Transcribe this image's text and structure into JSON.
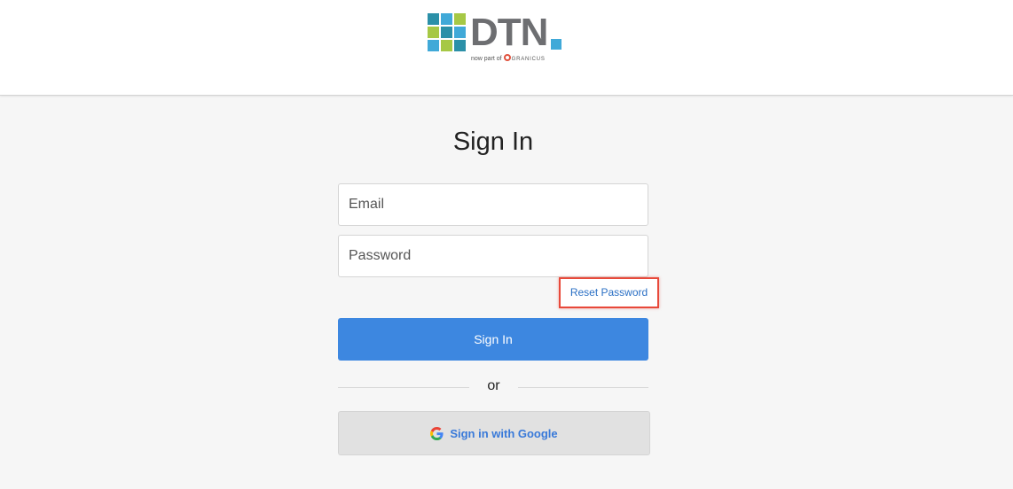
{
  "header": {
    "logo_text": "DTN",
    "logo_tagline_prefix": "now part of",
    "logo_tagline_brand": "GRANICUS",
    "logo_colors": {
      "blue": "#40a9d8",
      "teal": "#2b90a8",
      "green": "#a6c845",
      "gray": "#6d6e71"
    }
  },
  "form": {
    "title": "Sign In",
    "email": {
      "placeholder": "Email",
      "value": ""
    },
    "password": {
      "placeholder": "Password",
      "value": ""
    },
    "reset_password_label": "Reset Password",
    "reset_highlight_color": "#e8493a",
    "signin_label": "Sign In",
    "signin_color": "#3d87e0",
    "divider_text": "or",
    "google_label": "Sign in with Google",
    "google_icon": "google-g-icon"
  }
}
